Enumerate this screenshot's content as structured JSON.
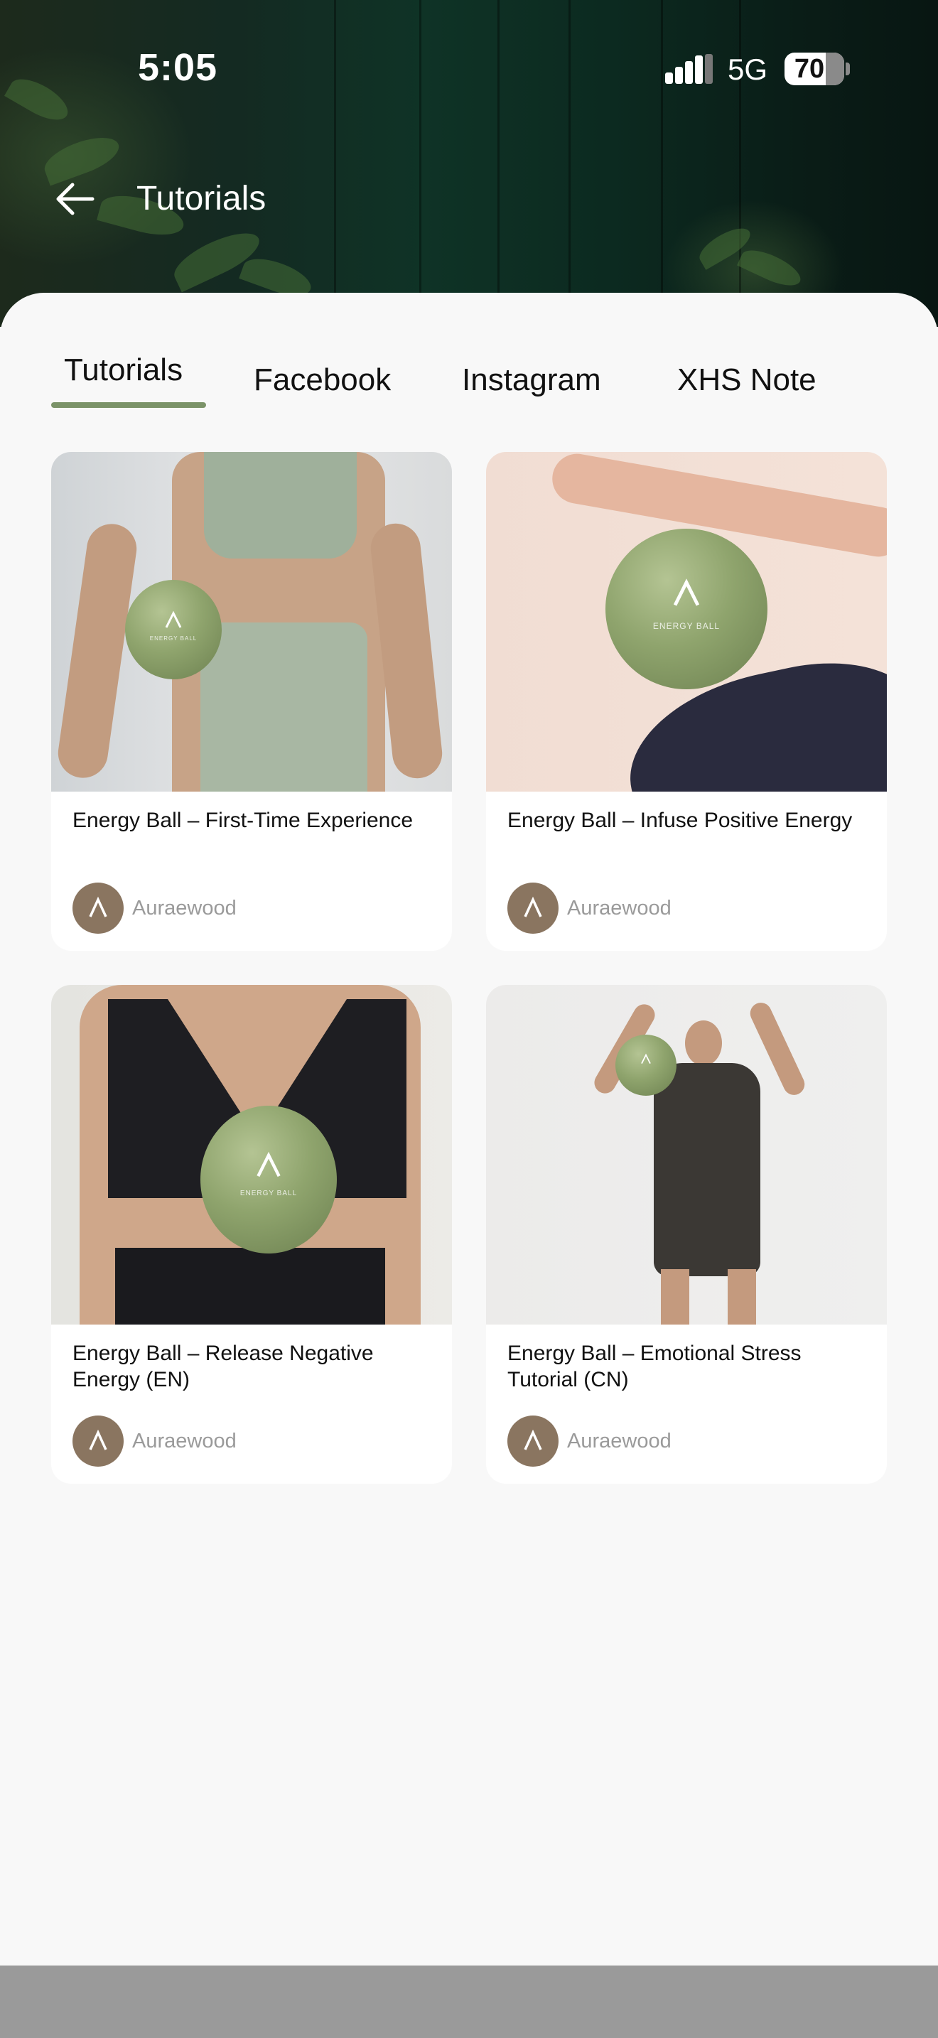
{
  "colors": {
    "accent": "#7b9368",
    "sheet_background": "#f8f8f8",
    "avatar_background": "#8a7560",
    "author_text": "#9a9a9a"
  },
  "status_bar": {
    "time": "5:05",
    "network": "5G",
    "battery": "70"
  },
  "nav": {
    "back_icon": "arrow-left-icon",
    "title": "Tutorials"
  },
  "tabs": [
    {
      "label": "Tutorials",
      "active": true
    },
    {
      "label": "Facebook",
      "active": false
    },
    {
      "label": "Instagram",
      "active": false
    },
    {
      "label": "XHS Note",
      "active": false
    }
  ],
  "cards": [
    {
      "title": "Energy Ball – First-Time Experience",
      "author": "Auraewood"
    },
    {
      "title": "Energy Ball – Infuse Positive Energy",
      "author": "Auraewood"
    },
    {
      "title": "Energy Ball – Release Negative Energy (EN)",
      "author": "Auraewood"
    },
    {
      "title": "Energy Ball – Emotional Stress Tutorial (CN)",
      "author": "Auraewood"
    }
  ],
  "product_mark": "ENERGY BALL"
}
